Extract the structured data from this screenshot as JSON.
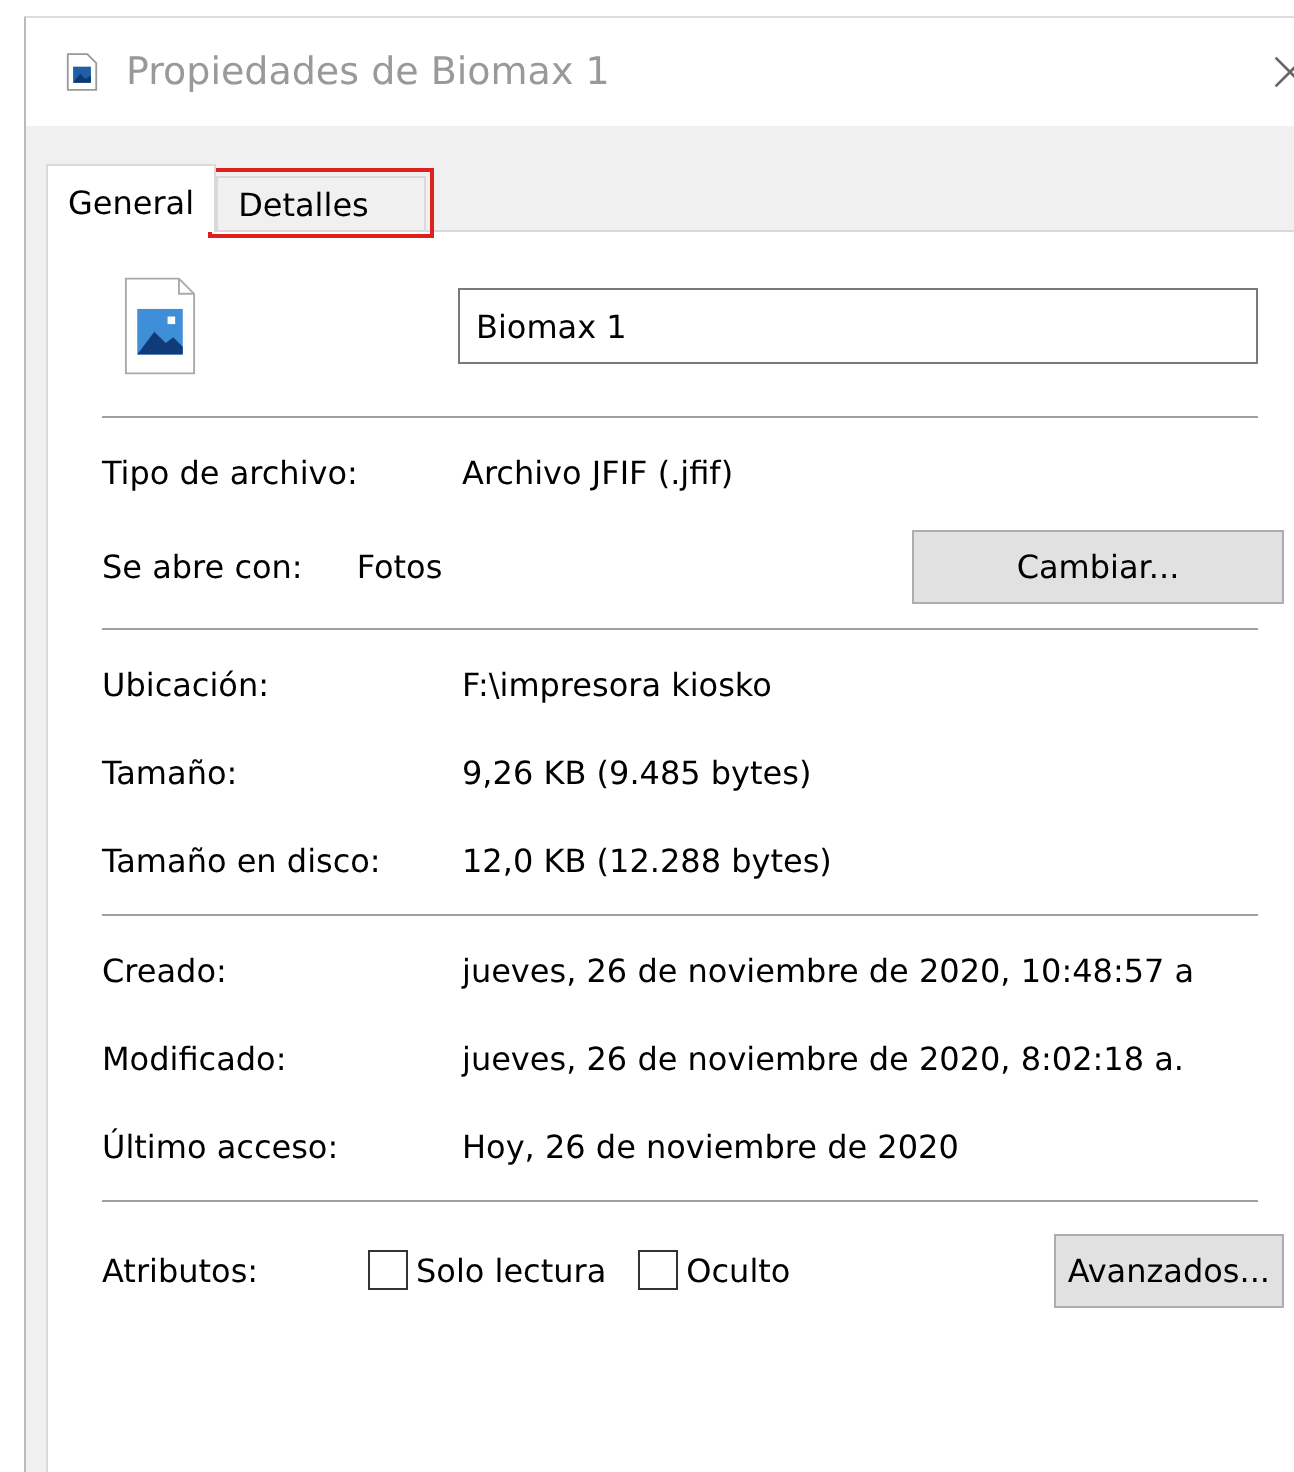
{
  "window": {
    "title": "Propiedades de Biomax 1"
  },
  "tabs": [
    {
      "label": "General",
      "selected": true,
      "highlighted": false
    },
    {
      "label": "Detalles",
      "selected": false,
      "highlighted": true
    }
  ],
  "name_field": {
    "value": "Biomax 1"
  },
  "sections": [
    [
      {
        "kind": "plain",
        "label": "Tipo de archivo:",
        "value": "Archivo JFIF (.jfif)"
      },
      {
        "kind": "button",
        "label": "Se abre con:",
        "value": "Fotos",
        "button": "Cambiar..."
      }
    ],
    [
      {
        "kind": "plain",
        "label": "Ubicación:",
        "value": "F:\\impresora kiosko"
      },
      {
        "kind": "plain",
        "label": "Tamaño:",
        "value": "9,26 KB (9.485 bytes)"
      },
      {
        "kind": "plain",
        "label": "Tamaño en disco:",
        "value": "12,0 KB (12.288 bytes)"
      }
    ],
    [
      {
        "kind": "plain",
        "label": "Creado:",
        "value": "jueves, 26 de noviembre de 2020, 10:48:57 a"
      },
      {
        "kind": "plain",
        "label": "Modificado:",
        "value": "jueves, 26 de noviembre de 2020, 8:02:18 a."
      },
      {
        "kind": "plain",
        "label": "Último acceso:",
        "value": "Hoy, 26 de noviembre de 2020"
      }
    ]
  ],
  "attributes": {
    "label": "Atributos:",
    "checkboxes": [
      {
        "label": "Solo lectura",
        "checked": false
      },
      {
        "label": "Oculto",
        "checked": false
      }
    ],
    "button": "Avanzados..."
  }
}
